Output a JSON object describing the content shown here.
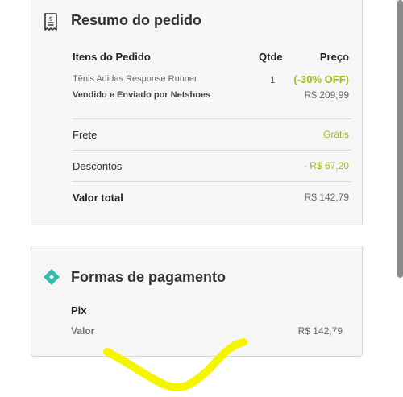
{
  "summary": {
    "title": "Resumo do pedido",
    "icon": "receipt-icon",
    "columns": {
      "items": "Itens do Pedido",
      "qty": "Qtde",
      "price": "Preço"
    },
    "item": {
      "name": "Tênis Adidas Response Runner",
      "seller": "Vendido e Enviado por Netshoes",
      "qty": "1",
      "discount_badge": "(-30% OFF)",
      "price": "R$ 209,99"
    },
    "shipping": {
      "label": "Frete",
      "value": "Grátis"
    },
    "discounts": {
      "label": "Descontos",
      "value": "- R$ 67,20"
    },
    "total": {
      "label": "Valor total",
      "value": "R$ 142,79"
    }
  },
  "payment": {
    "title": "Formas de pagamento",
    "icon": "pix-icon",
    "method": "Pix",
    "amount_label": "Valor",
    "amount_value": "R$ 142,79"
  },
  "colors": {
    "accent_green": "#9fbf1a",
    "pix_teal": "#32bcad",
    "annotation_yellow": "#f5f500"
  }
}
